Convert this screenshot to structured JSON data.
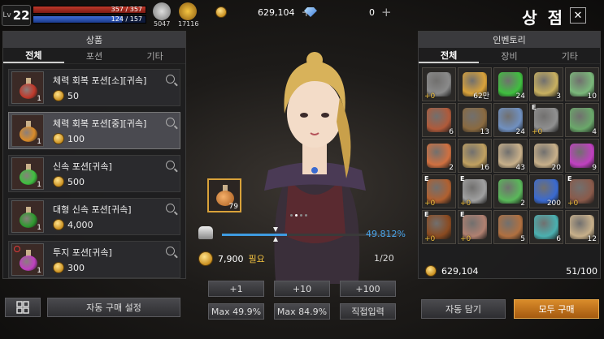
{
  "hud": {
    "level_label": "Lv",
    "level": "22",
    "hp": "357 / 357",
    "mp": "124 / 157",
    "feather_count": "5047",
    "phoenix_count": "17116",
    "gold": "629,104",
    "gems": "0"
  },
  "window": {
    "title": "상 점",
    "close": "✕"
  },
  "shop": {
    "header": "상품",
    "tabs": [
      "전체",
      "포션",
      "기타"
    ],
    "items": [
      {
        "name": "체력 회복 포션[소][귀속]",
        "price": "50",
        "count": "1",
        "color": "#c0392b"
      },
      {
        "name": "체력 회복 포션[중][귀속]",
        "price": "100",
        "count": "1",
        "color": "#d98b2a"
      },
      {
        "name": "신속 포션[귀속]",
        "price": "500",
        "count": "1",
        "color": "#3fbf3f"
      },
      {
        "name": "대형 신속 포션[귀속]",
        "price": "4,000",
        "count": "1",
        "color": "#2f9a2f"
      },
      {
        "name": "투지 포션[귀속]",
        "price": "300",
        "count": "1",
        "color": "#c040c0"
      }
    ]
  },
  "left_buttons": {
    "auto_buy_settings": "자동 구매 설정"
  },
  "purchase": {
    "selected_count": "79",
    "slider_percent": "49.812%",
    "cost": "7,900",
    "cost_suffix": "필요",
    "quantity": "1/20",
    "buttons": [
      "+1",
      "+10",
      "+100",
      "Max 49.9%",
      "Max 84.9%",
      "직접입력"
    ]
  },
  "inventory": {
    "header": "인벤토리",
    "tabs": [
      "전체",
      "장비",
      "기타"
    ],
    "slots": [
      {
        "icon": "mace-icon",
        "enchant": "+0",
        "count": "",
        "equip": "",
        "color": "#8a8a8a"
      },
      {
        "icon": "coin-r-icon",
        "enchant": "",
        "count": "62만",
        "equip": "",
        "color": "#d9a23a"
      },
      {
        "icon": "green-potion-icon",
        "enchant": "",
        "count": "24",
        "equip": "",
        "color": "#3fbf3f"
      },
      {
        "icon": "fan-icon",
        "enchant": "",
        "count": "3",
        "equip": "",
        "color": "#c8b060"
      },
      {
        "icon": "leaf-stone-icon",
        "enchant": "",
        "count": "10",
        "equip": "",
        "color": "#7ab87a"
      },
      {
        "icon": "book-icon",
        "enchant": "",
        "count": "6",
        "equip": "",
        "color": "#b05a3a"
      },
      {
        "icon": "chest-icon",
        "enchant": "",
        "count": "13",
        "equip": "",
        "color": "#8a6a40"
      },
      {
        "icon": "sword-icon",
        "enchant": "",
        "count": "24",
        "equip": "",
        "color": "#7090c0"
      },
      {
        "icon": "blade-icon",
        "enchant": "+0",
        "count": "",
        "equip": "E",
        "color": "#909090"
      },
      {
        "icon": "amulet-icon",
        "enchant": "",
        "count": "4",
        "equip": "",
        "color": "#6aa86a"
      },
      {
        "icon": "food-bowl-icon",
        "enchant": "",
        "count": "2",
        "equip": "",
        "color": "#d07040"
      },
      {
        "icon": "gold-chest-icon",
        "enchant": "",
        "count": "16",
        "equip": "",
        "color": "#c0a060"
      },
      {
        "icon": "scroll-icon",
        "enchant": "",
        "count": "43",
        "equip": "",
        "color": "#c8b08a"
      },
      {
        "icon": "scroll-icon",
        "enchant": "",
        "count": "20",
        "equip": "",
        "color": "#c8b08a"
      },
      {
        "icon": "purple-potion-icon",
        "enchant": "",
        "count": "9",
        "equip": "",
        "color": "#c040c0"
      },
      {
        "icon": "gauntlet-icon",
        "enchant": "+0",
        "count": "",
        "equip": "E",
        "color": "#b06030"
      },
      {
        "icon": "armor-icon",
        "enchant": "+0",
        "count": "",
        "equip": "E",
        "color": "#a0a0a0"
      },
      {
        "icon": "green-scroll-icon",
        "enchant": "",
        "count": "2",
        "equip": "",
        "color": "#5ab85a"
      },
      {
        "icon": "star-coin-icon",
        "enchant": "",
        "count": "200",
        "equip": "",
        "color": "#3a6ad0"
      },
      {
        "icon": "boots-icon",
        "enchant": "+0",
        "count": "",
        "equip": "E",
        "color": "#8a5a4a"
      },
      {
        "icon": "wig-icon",
        "enchant": "+0",
        "count": "",
        "equip": "E",
        "color": "#8a4a20"
      },
      {
        "icon": "staff-icon",
        "enchant": "+0",
        "count": "",
        "equip": "E",
        "color": "#b08070"
      },
      {
        "icon": "card-icon",
        "enchant": "",
        "count": "5",
        "equip": "",
        "color": "#b07040"
      },
      {
        "icon": "crystal-icon",
        "enchant": "",
        "count": "6",
        "equip": "",
        "color": "#4ab0b0"
      },
      {
        "icon": "scroll-icon",
        "enchant": "",
        "count": "12",
        "equip": "",
        "color": "#c8b08a"
      }
    ],
    "gold": "629,104",
    "capacity": "51/100"
  },
  "right_buttons": {
    "auto_add": "자동 담기",
    "buy_all": "모두 구매"
  }
}
